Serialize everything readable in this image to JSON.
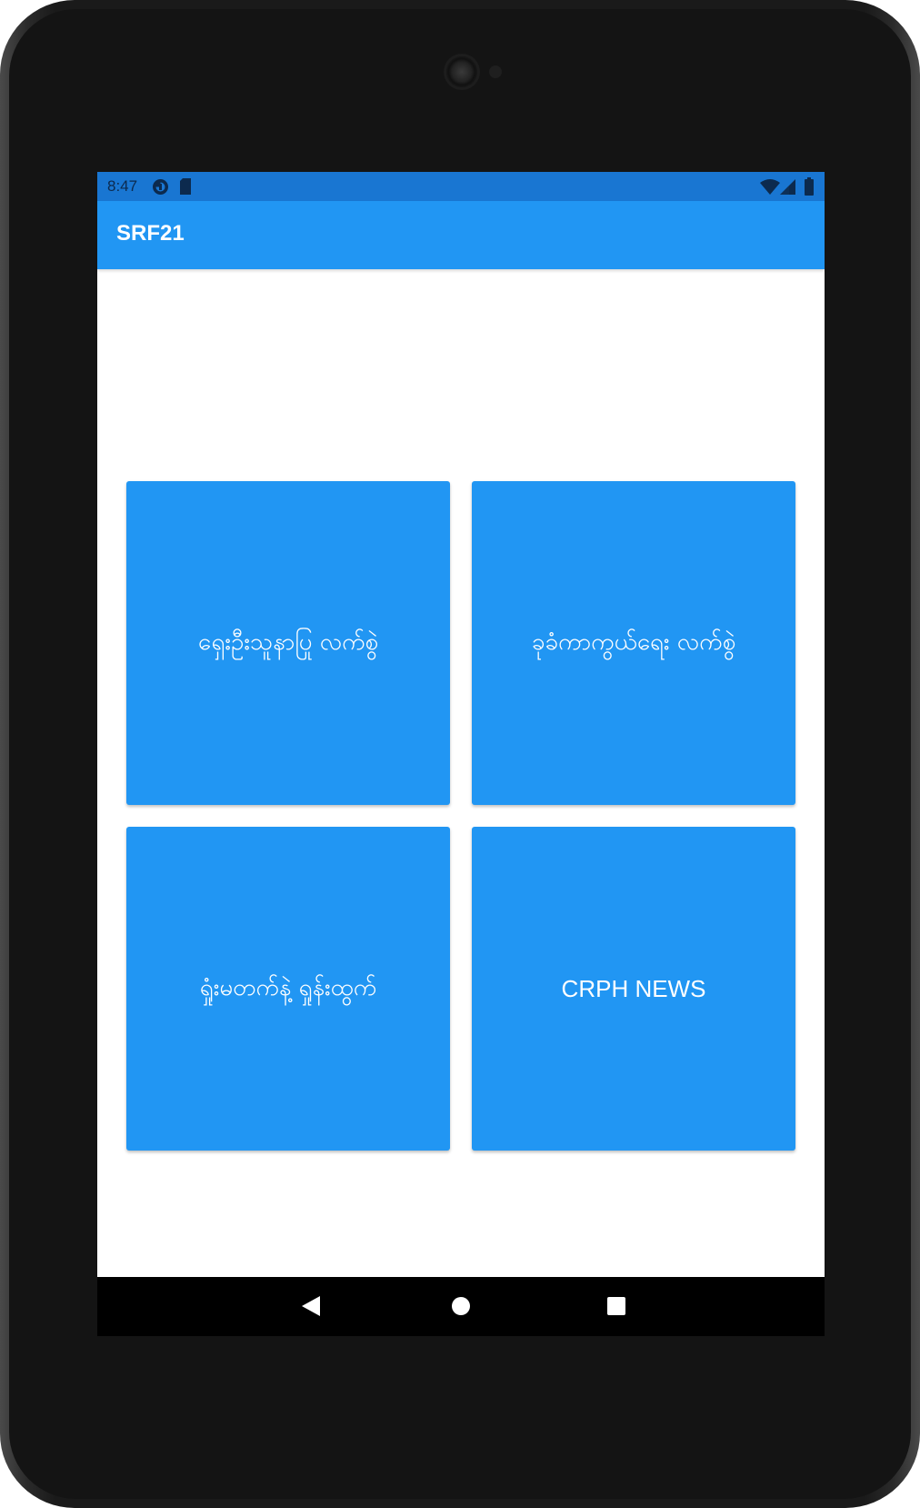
{
  "status_bar": {
    "time": "8:47",
    "left_icons": [
      "data-saver-icon",
      "sd-card-icon"
    ],
    "right_icons": [
      "wifi-icon",
      "cell-signal-icon",
      "battery-icon"
    ]
  },
  "app_bar": {
    "title": "SRF21"
  },
  "tiles": [
    {
      "label": "ရှေးဦးသူနာပြု လက်စွဲ"
    },
    {
      "label": "ခုခံကာကွယ်ရေး လက်စွဲ"
    },
    {
      "label": "ရှုံးမတက်နဲ့ ရှုန်းထွက်"
    },
    {
      "label": "CRPH NEWS"
    }
  ],
  "nav_bar": {
    "buttons": [
      "back-icon",
      "home-icon",
      "recents-icon"
    ]
  },
  "colors": {
    "status_bar": "#1976d2",
    "app_bar": "#2196f3",
    "tile": "#2196f3",
    "nav_bar": "#000000",
    "bezel": "#141414"
  }
}
